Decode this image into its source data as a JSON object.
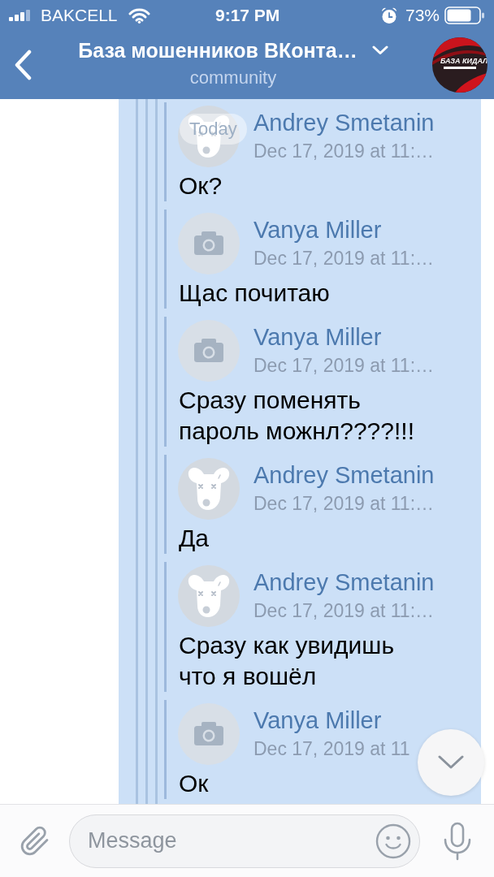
{
  "status_bar": {
    "carrier": "BAKCELL",
    "time": "9:17 PM",
    "battery": "73%"
  },
  "header": {
    "title": "База мошенников ВКонта…",
    "subtitle": "community",
    "avatar_text": "БАЗА КИДАЛ"
  },
  "date_badge": "Today",
  "chat": {
    "highlighted": true,
    "children": [
      {
        "children": [
          {
            "children": [
              {
                "children": [
                  {
                    "kind": "deactivated",
                    "author": "Andrey Smetanin",
                    "date": "Dec 17, 2019 at 11:…",
                    "text": "Ок?"
                  },
                  {
                    "kind": "nophoto",
                    "author": "Vanya Miller",
                    "date": "Dec 17, 2019 at 11:…",
                    "text": "Щас почитаю"
                  },
                  {
                    "kind": "nophoto",
                    "author": "Vanya Miller",
                    "date": "Dec 17, 2019 at 11:…",
                    "text": "Сразу поменять пароль можнл????!!!"
                  },
                  {
                    "kind": "deactivated",
                    "author": "Andrey Smetanin",
                    "date": "Dec 17, 2019 at 11:…",
                    "text": "Да"
                  },
                  {
                    "kind": "deactivated",
                    "author": "Andrey Smetanin",
                    "date": "Dec 17, 2019 at 11:…",
                    "text": "Сразу как увидишь что я вошёл"
                  },
                  {
                    "kind": "nophoto",
                    "author": "Vanya Miller",
                    "date": "Dec 17, 2019 at 11",
                    "text": "Ок"
                  }
                ]
              }
            ]
          }
        ]
      }
    ]
  },
  "composer": {
    "placeholder": "Message"
  }
}
